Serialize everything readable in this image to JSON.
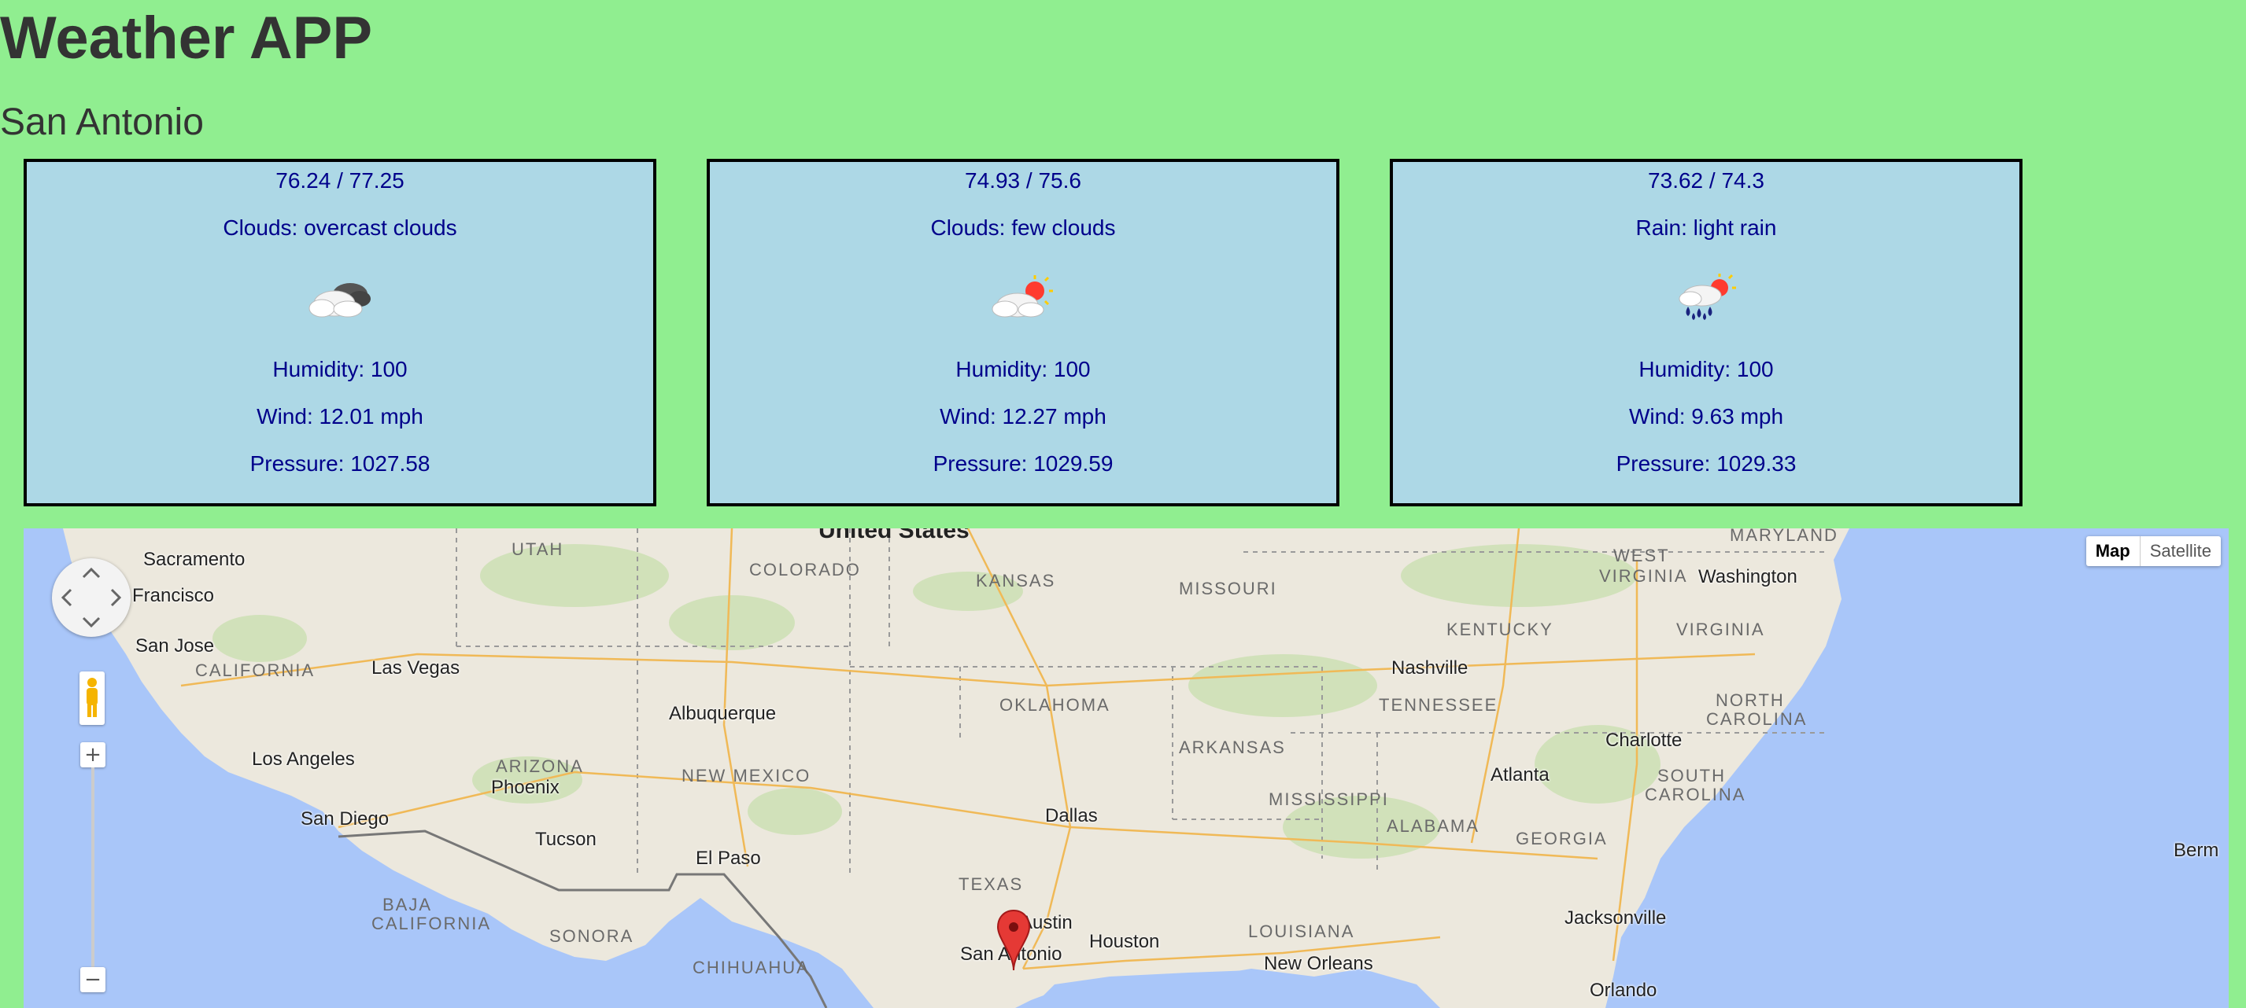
{
  "app": {
    "title": "Weather APP",
    "city": "San Antonio"
  },
  "forecasts": [
    {
      "temps": "76.24 / 77.25",
      "description": "Clouds: overcast clouds",
      "icon": "overcast-clouds-icon",
      "humidity": "Humidity: 100",
      "wind": "Wind: 12.01 mph",
      "pressure": "Pressure: 1027.58"
    },
    {
      "temps": "74.93 / 75.6",
      "description": "Clouds: few clouds",
      "icon": "few-clouds-icon",
      "humidity": "Humidity: 100",
      "wind": "Wind: 12.27 mph",
      "pressure": "Pressure: 1029.59"
    },
    {
      "temps": "73.62 / 74.3",
      "description": "Rain: light rain",
      "icon": "light-rain-icon",
      "humidity": "Humidity: 100",
      "wind": "Wind: 9.63 mph",
      "pressure": "Pressure: 1029.33"
    }
  ],
  "map": {
    "type_map": "Map",
    "type_satellite": "Satellite",
    "zoom_in": "+",
    "zoom_out": "−",
    "country": "United States",
    "states": [
      "UTAH",
      "COLORADO",
      "KANSAS",
      "MISSOURI",
      "WEST",
      "VIRGINIA",
      "MARYLAND",
      "CALIFORNIA",
      "KENTUCKY",
      "VIRGINIA",
      "OKLAHOMA",
      "TENNESSEE",
      "NORTH",
      "CAROLINA",
      "ARIZONA",
      "NEW MEXICO",
      "ARKANSAS",
      "SOUTH",
      "CAROLINA",
      "MISSISSIPPI",
      "ALABAMA",
      "GEORGIA",
      "TEXAS",
      "BAJA",
      "CALIFORNIA",
      "SONORA",
      "CHIHUAHUA",
      "LOUISIANA"
    ],
    "cities": [
      "Sacramento",
      "Francisco",
      "San Jose",
      "Las Vegas",
      "Washington",
      "Nashville",
      "Albuquerque",
      "Charlotte",
      "Los Angeles",
      "Phoenix",
      "Atlanta",
      "San Diego",
      "Tucson",
      "Dallas",
      "El Paso",
      "Austin",
      "San Antonio",
      "Houston",
      "Jacksonville",
      "New Orleans",
      "Orlando",
      "Berm"
    ],
    "marker": "map-marker-icon"
  },
  "colors": {
    "page_bg": "#90ee90",
    "card_bg": "#add8e6",
    "card_text": "#00008b",
    "ocean": "#a9c6f9",
    "land": "#ece8dd"
  }
}
